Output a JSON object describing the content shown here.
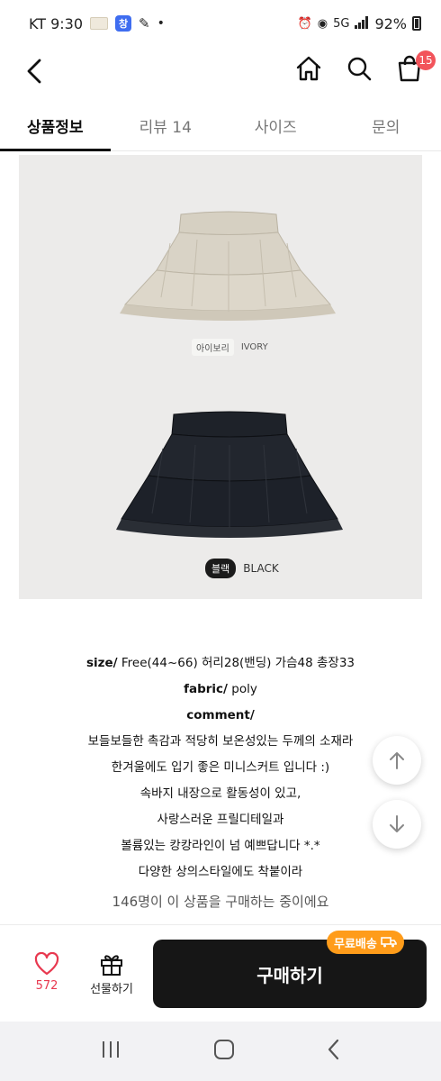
{
  "status_bar": {
    "carrier_time": "KT 9:30",
    "notif_chip": "창",
    "dot": "•",
    "network": "5G",
    "battery": "92%"
  },
  "app_bar": {
    "cart_count": "15"
  },
  "tabs": [
    {
      "label": "상품정보",
      "active": true
    },
    {
      "label": "리뷰 14",
      "active": false
    },
    {
      "label": "사이즈",
      "active": false
    },
    {
      "label": "문의",
      "active": false
    }
  ],
  "product_image": {
    "ivory_label_kr": "아이보리",
    "ivory_label_en": "IVORY",
    "black_label_kr": "블랙",
    "black_label_en": "BLACK",
    "colors": {
      "background": "#ecebea",
      "ivory": "#d9d3c6",
      "black": "#1d2129"
    }
  },
  "description": {
    "size_label": "size/",
    "size_value": " Free(44~66) 허리28(밴딩) 가슴48 총장33",
    "fabric_label": "fabric/",
    "fabric_value": " poly",
    "comment_label": "comment/",
    "lines": [
      "보들보들한 촉감과 적당히 보온성있는 두께의 소재라",
      "한겨울에도 입기 좋은 미니스커트 입니다 :)",
      "속바지 내장으로 활동성이 있고,",
      "사랑스러운 프릴디테일과",
      "볼륨있는 캉캉라인이 넘 예쁘답니다 *.*",
      "다양한 상의스타일에도 착붙이라"
    ]
  },
  "notice": "146명이 이 상품을 구매하는 중이에요",
  "bottom_bar": {
    "like_count": "572",
    "gift_label": "선물하기",
    "buy_label": "구매하기",
    "free_shipping_label": "무료배송",
    "accent_color": "#e8384f",
    "badge_color": "#ff9c1a"
  }
}
